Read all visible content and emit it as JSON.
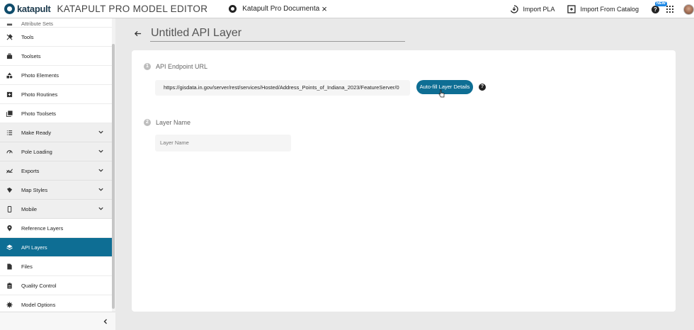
{
  "header": {
    "logo_text": "katapult",
    "app_title": "KATAPULT PRO MODEL EDITOR",
    "doc_tab_label": "Katapult Pro Documenta",
    "doc_close": "×",
    "import_pla_label": "Import PLA",
    "import_catalog_label": "Import From Catalog",
    "help_glyph": "?",
    "new_badge": "NEW"
  },
  "sidebar": {
    "partial_item": "Attribute Sets",
    "items": [
      {
        "label": "Tools",
        "icon": "tools-icon"
      },
      {
        "label": "Toolsets",
        "icon": "toolbox-icon"
      },
      {
        "label": "Photo Elements",
        "icon": "shapes-icon"
      },
      {
        "label": "Photo Routines",
        "icon": "add-box-icon"
      },
      {
        "label": "Photo Toolsets",
        "icon": "photo-stack-icon"
      },
      {
        "label": "Make Ready",
        "icon": "list-icon",
        "expandable": true
      },
      {
        "label": "Pole Loading",
        "icon": "gauge-icon",
        "expandable": true
      },
      {
        "label": "Exports",
        "icon": "chart-line-icon",
        "expandable": true
      },
      {
        "label": "Map Styles",
        "icon": "map-styles-icon",
        "expandable": true
      },
      {
        "label": "Mobile",
        "icon": "phone-icon",
        "expandable": true
      },
      {
        "label": "Reference Layers",
        "icon": "map-pin-icon"
      },
      {
        "label": "API Layers",
        "icon": "layers-icon",
        "active": true
      },
      {
        "label": "Files",
        "icon": "file-icon"
      },
      {
        "label": "Quality Control",
        "icon": "clipboard-icon"
      },
      {
        "label": "Model Options",
        "icon": "gear-icon"
      }
    ]
  },
  "main": {
    "title_value": "Untitled API Layer",
    "step1_number": "1",
    "step1_label": "API Endpoint URL",
    "url_value": "https://gisdata.in.gov/server/rest/services/Hosted/Address_Points_of_Indiana_2023/FeatureServer/0",
    "autofill_label": "Auto-fill Layer Details",
    "help_glyph": "?",
    "step2_number": "2",
    "step2_label": "Layer Name",
    "name_placeholder": "Layer Name"
  },
  "colors": {
    "accent": "#0e6e94",
    "group_bg": "#efefef",
    "page_bg": "#e9e9e9"
  }
}
